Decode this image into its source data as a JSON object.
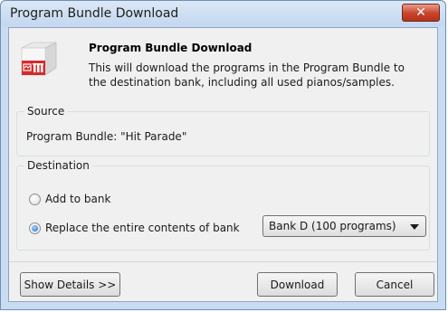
{
  "window": {
    "title": "Program Bundle Download"
  },
  "header": {
    "title": "Program Bundle Download",
    "description": "This will download the programs in the Program Bundle to the destination bank, including all used pianos/samples."
  },
  "source": {
    "label": "Source",
    "text": "Program Bundle: \"Hit Parade\""
  },
  "destination": {
    "label": "Destination",
    "options": [
      {
        "label": "Add to bank",
        "selected": false
      },
      {
        "label": "Replace the entire contents of bank",
        "selected": true
      }
    ],
    "bank_select": {
      "value": "Bank D (100 programs)"
    }
  },
  "buttons": {
    "details": "Show Details >>",
    "download": "Download",
    "cancel": "Cancel"
  },
  "colors": {
    "close_button": "#c7432a",
    "icon_red": "#d62b2b",
    "radio_selected": "#1c6bc6"
  }
}
